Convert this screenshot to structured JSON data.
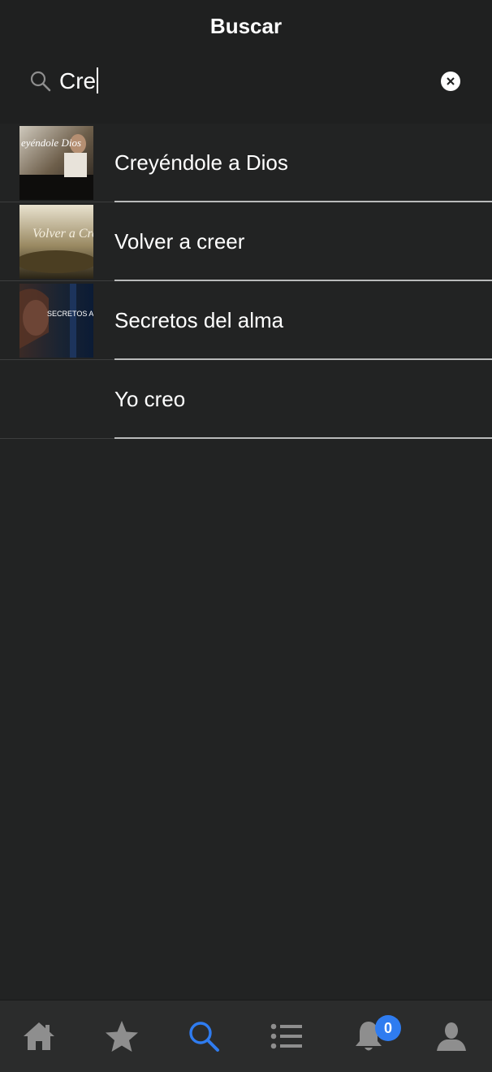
{
  "header": {
    "title": "Buscar"
  },
  "search": {
    "value": "Cre"
  },
  "results": [
    {
      "title": "Creyéndole a Dios",
      "thumb_text": "eyéndole Dios"
    },
    {
      "title": "Volver a creer",
      "thumb_text": "Volver a Creer"
    },
    {
      "title": "Secretos del alma",
      "thumb_text": "SECRETOS A"
    },
    {
      "title": "Yo creo"
    }
  ],
  "tabbar": {
    "items": [
      "home-icon",
      "star-icon",
      "search-icon",
      "list-icon",
      "bell-icon",
      "profile-icon"
    ],
    "active_color": "#2f7cf0",
    "notification_count": "0"
  }
}
